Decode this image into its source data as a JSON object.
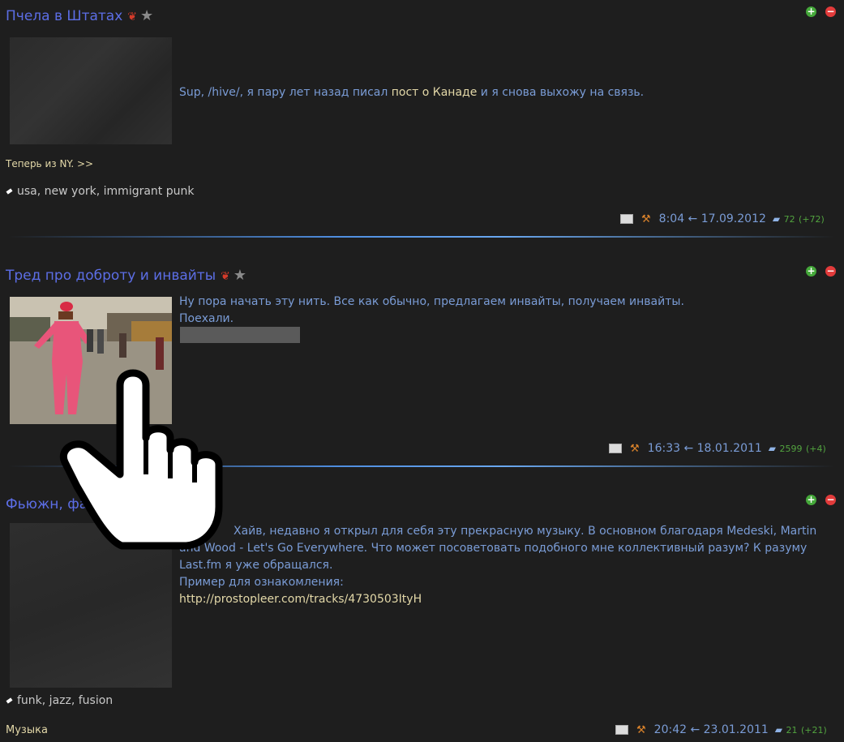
{
  "posts": [
    {
      "title": "Пчела в Штатах",
      "body_parts": [
        "Sup, /hive/, я пару лет назад писал ",
        "пост о Канаде",
        " и я снова выхожу на связь."
      ],
      "more_link": "Теперь из NY. >>",
      "tags": "usa, new york, immigrant punk",
      "time": "8:04 ← 17.09.2012",
      "comments": "72",
      "comments_new": "(+72)"
    },
    {
      "title": "Тред про доброту и инвайты",
      "body_lines": [
        "Ну пора начать эту нить. Все как обычно, предлагаем инвайты, получаем инвайты.",
        "Поехали."
      ],
      "time": "16:33 ← 18.01.2011",
      "comments": "2599",
      "comments_new": "(+4)"
    },
    {
      "title": "Фьюжн, фанк",
      "body_lines": [
        "Хайв, недавно я открыл для себя эту прекрасную музыку. В основном благодаря Medeski, Martin",
        "and Wood - Let's Go Everywhere. Что может посоветовать подобного мне коллективный разум? К разуму",
        "Last.fm я уже обращался.",
        "Пример для ознакомления:"
      ],
      "link": "http://prostopleer.com/tracks/4730503ItyH",
      "tags": "funk, jazz, fusion",
      "category": "Музыка",
      "time": "20:42 ← 23.01.2011",
      "comments": "21",
      "comments_new": "(+21)"
    }
  ],
  "icons": {
    "vote_up": "+",
    "vote_down": "−",
    "star": "★",
    "comment": "💬"
  }
}
